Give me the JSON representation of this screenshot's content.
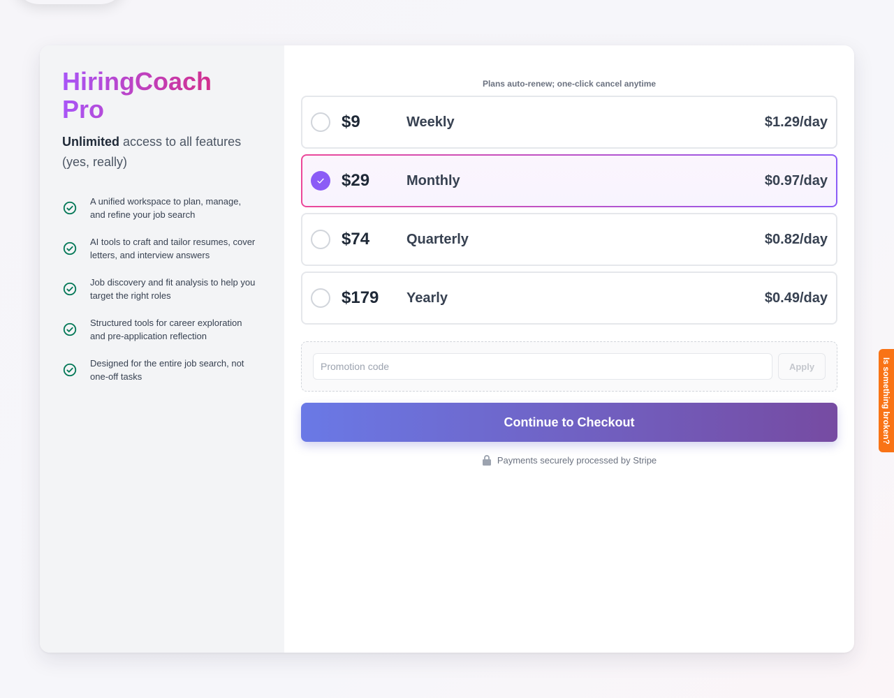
{
  "brand": {
    "name": "HiringCoach Pro"
  },
  "tagline": {
    "bold": "Unlimited",
    "rest": " access to all features (yes, really)"
  },
  "features": [
    {
      "icon": "check-circle-icon",
      "text": "A unified workspace to plan, manage, and refine your job search"
    },
    {
      "icon": "check-circle-icon",
      "text": "AI tools to craft and tailor resumes, cover letters, and interview answers"
    },
    {
      "icon": "check-circle-icon",
      "text": "Job discovery and fit analysis to help you target the right roles"
    },
    {
      "icon": "check-circle-icon",
      "text": "Structured tools for career exploration and pre-application reflection"
    },
    {
      "icon": "check-circle-icon",
      "text": "Designed for the entire job search, not one-off tasks"
    }
  ],
  "plans_note": "Plans auto-renew; one-click cancel anytime",
  "plans": [
    {
      "price": "$9",
      "period": "Weekly",
      "per_day": "$1.29/day",
      "selected": false
    },
    {
      "price": "$29",
      "period": "Monthly",
      "per_day": "$0.97/day",
      "selected": true
    },
    {
      "price": "$74",
      "period": "Quarterly",
      "per_day": "$0.82/day",
      "selected": false
    },
    {
      "price": "$179",
      "period": "Yearly",
      "per_day": "$0.49/day",
      "selected": false
    }
  ],
  "promo": {
    "placeholder": "Promotion code",
    "value": "",
    "apply_label": "Apply"
  },
  "checkout": {
    "label": "Continue to Checkout"
  },
  "secure_note": "Payments securely processed by Stripe",
  "feedback_tab": {
    "label": "Is something broken?"
  },
  "colors": {
    "accent_purple": "#8b5cf6",
    "brand_gradient_start": "#a855f7",
    "brand_gradient_end": "#db2777",
    "check_green": "#047857",
    "checkout_gradient_start": "#6a79e6",
    "checkout_gradient_end": "#764ba2",
    "feedback_orange": "#f97316"
  }
}
